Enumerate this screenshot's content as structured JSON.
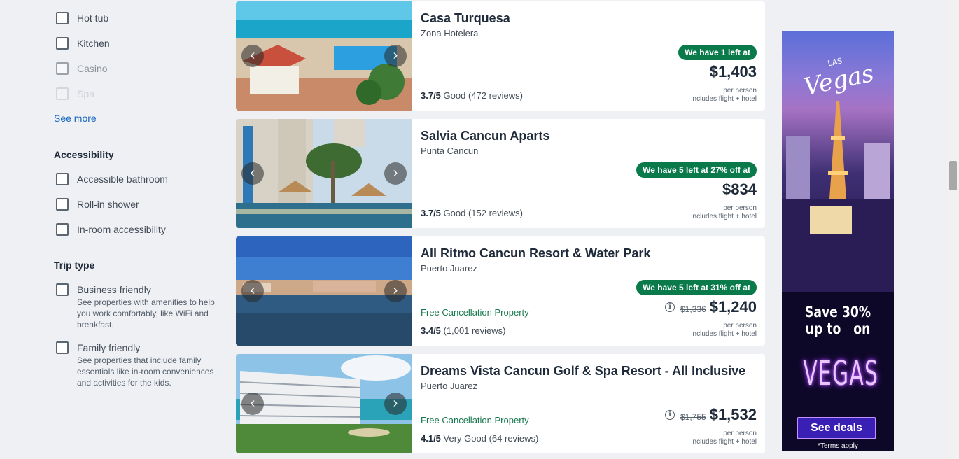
{
  "filters": {
    "amenities": [
      "Hot tub",
      "Kitchen",
      "Casino",
      "Spa"
    ],
    "see_more": "See more",
    "accessibility": {
      "title": "Accessibility",
      "items": [
        "Accessible bathroom",
        "Roll-in shower",
        "In-room accessibility"
      ]
    },
    "trip_type": {
      "title": "Trip type",
      "items": [
        {
          "label": "Business friendly",
          "desc": "See properties with amenities to help you work comfortably, like WiFi and breakfast."
        },
        {
          "label": "Family friendly",
          "desc": "See properties that include family essentials like in-room conveniences and activities for the kids."
        }
      ]
    }
  },
  "nav_icons": {
    "prev": "‹",
    "next": "›",
    "info": "i"
  },
  "hotels": [
    {
      "name": "Casa Turquesa",
      "location": "Zona Hotelera",
      "rating": "3.7/5",
      "rating_text": "Good (472 reviews)",
      "badge": "We have 1 left at",
      "price": "$1,403",
      "old_price": "",
      "free_cancel": "",
      "per_person": "per person",
      "includes": "includes flight + hotel"
    },
    {
      "name": "Salvia Cancun Aparts",
      "location": "Punta Cancun",
      "rating": "3.7/5",
      "rating_text": "Good (152 reviews)",
      "badge": "We have 5 left at 27% off at",
      "price": "$834",
      "old_price": "",
      "free_cancel": "",
      "per_person": "per person",
      "includes": "includes flight + hotel"
    },
    {
      "name": "All Ritmo Cancun Resort & Water Park",
      "location": "Puerto Juarez",
      "rating": "3.4/5",
      "rating_text": "(1,001 reviews)",
      "badge": "We have 5 left at 31% off at",
      "price": "$1,240",
      "old_price": "$1,336",
      "free_cancel": "Free Cancellation Property",
      "per_person": "per person",
      "includes": "includes flight + hotel"
    },
    {
      "name": "Dreams Vista Cancun Golf & Spa Resort - All Inclusive",
      "location": "Puerto Juarez",
      "rating": "4.1/5",
      "rating_text": "Very Good (64 reviews)",
      "badge": "",
      "price": "$1,532",
      "old_price": "$1,755",
      "free_cancel": "Free Cancellation Property",
      "per_person": "per person",
      "includes": "includes flight + hotel"
    }
  ],
  "ad": {
    "logo_small": "LAS",
    "logo": "Vegas",
    "save_line1": "Save 30%",
    "save_line2": "up to   on",
    "headline": "VEGAS",
    "button": "See deals",
    "terms": "*Terms apply"
  }
}
